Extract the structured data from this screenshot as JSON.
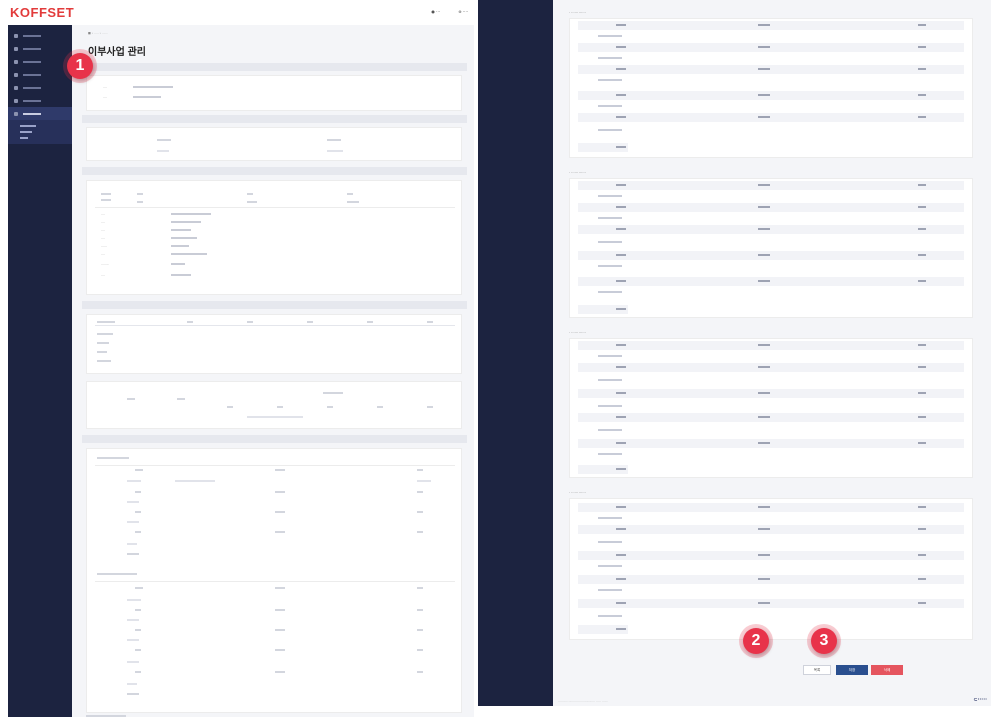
{
  "app": {
    "logo": "KOFFSET"
  },
  "header": {
    "user": "●  ···",
    "logout": "⊕ ····"
  },
  "page": {
    "title": "이부사업 관리",
    "breadcrumb": "■ › ····· › ······"
  },
  "markers": [
    "1",
    "2",
    "3"
  ],
  "actions": {
    "list": "목록",
    "save": "저장",
    "delete": "삭제"
  },
  "colors": {
    "logo": "#e23b3b",
    "sidebar": "#1c2340",
    "badge": "#e8334a",
    "save_button": "#2a4f8f",
    "delete_button": "#e5555f"
  }
}
